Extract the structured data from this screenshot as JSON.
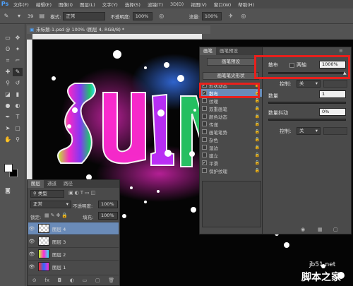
{
  "menubar": {
    "logo": "Ps",
    "items": [
      "文件(F)",
      "编辑(E)",
      "图像(I)",
      "图层(L)",
      "文字(Y)",
      "选择(S)",
      "滤镜(T)",
      "3D(D)",
      "视图(V)",
      "窗口(W)",
      "帮助(H)"
    ]
  },
  "options": {
    "mode_label": "模式:",
    "mode_value": "正常",
    "opacity_label": "不透明度:",
    "opacity_value": "100%",
    "flow_label": "流量:",
    "flow_value": "100%",
    "brush_size": "39"
  },
  "document": {
    "tab_title": "未标题-1.psd @ 100% (图层 4, RGB/8) *"
  },
  "brush_panel": {
    "tabs": [
      "画笔",
      "画笔预设"
    ],
    "preset_button": "画笔预设",
    "tip_shape_button": "画笔笔尖形状",
    "items": [
      {
        "label": "形状动态",
        "checked": true
      },
      {
        "label": "散布",
        "checked": true
      },
      {
        "label": "纹理",
        "checked": false
      },
      {
        "label": "双重画笔",
        "checked": false
      },
      {
        "label": "颜色动态",
        "checked": false
      },
      {
        "label": "传递",
        "checked": false
      },
      {
        "label": "画笔笔势",
        "checked": false
      },
      {
        "label": "杂色",
        "checked": false
      },
      {
        "label": "湿边",
        "checked": false
      },
      {
        "label": "建立",
        "checked": false
      },
      {
        "label": "平滑",
        "checked": true
      },
      {
        "label": "保护纹理",
        "checked": false
      }
    ],
    "scatter": {
      "label": "散布",
      "both_axes": "两轴",
      "value": "1000%",
      "control_label": "控制:",
      "control_value": "关",
      "count_label": "数量",
      "count_value": "1",
      "jitter_label": "数量抖动",
      "jitter_value": "0%",
      "control2_label": "控制:",
      "control2_value": "关"
    }
  },
  "layers_panel": {
    "tabs": [
      "图层",
      "通道",
      "路径"
    ],
    "kind_label": "类型",
    "blend_mode": "正常",
    "opacity_label": "不透明度:",
    "opacity_value": "100%",
    "lock_label": "锁定:",
    "fill_label": "填充:",
    "fill_value": "100%",
    "layers": [
      {
        "name": "图层 4"
      },
      {
        "name": "图层 3"
      },
      {
        "name": "图层 2"
      },
      {
        "name": "图层 1"
      }
    ]
  },
  "watermark": {
    "site": "jb51.net",
    "name": "脚本之家"
  },
  "colors": {
    "highlight": "#e8201c",
    "selection": "#6a8bb8",
    "ps_blue": "#4ea3ff"
  }
}
